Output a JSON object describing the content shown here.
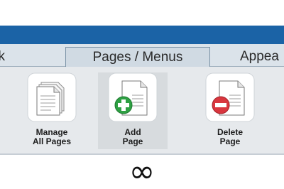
{
  "tabs": {
    "back_partial": "ck",
    "pages_menus": "Pages / Menus",
    "appearance_partial": "Appea"
  },
  "tools": {
    "manage": {
      "line1": "Manage",
      "line2": "All Pages",
      "icon": "stacked-pages-icon"
    },
    "add": {
      "line1": "Add",
      "line2": "Page",
      "icon": "add-page-icon"
    },
    "delete": {
      "line1": "Delete",
      "line2": "Page",
      "icon": "delete-page-icon"
    }
  },
  "footer": {
    "symbol": "∞"
  },
  "colors": {
    "header_blue": "#1b63a6",
    "add_green": "#2ea043",
    "delete_red": "#d9363e"
  }
}
